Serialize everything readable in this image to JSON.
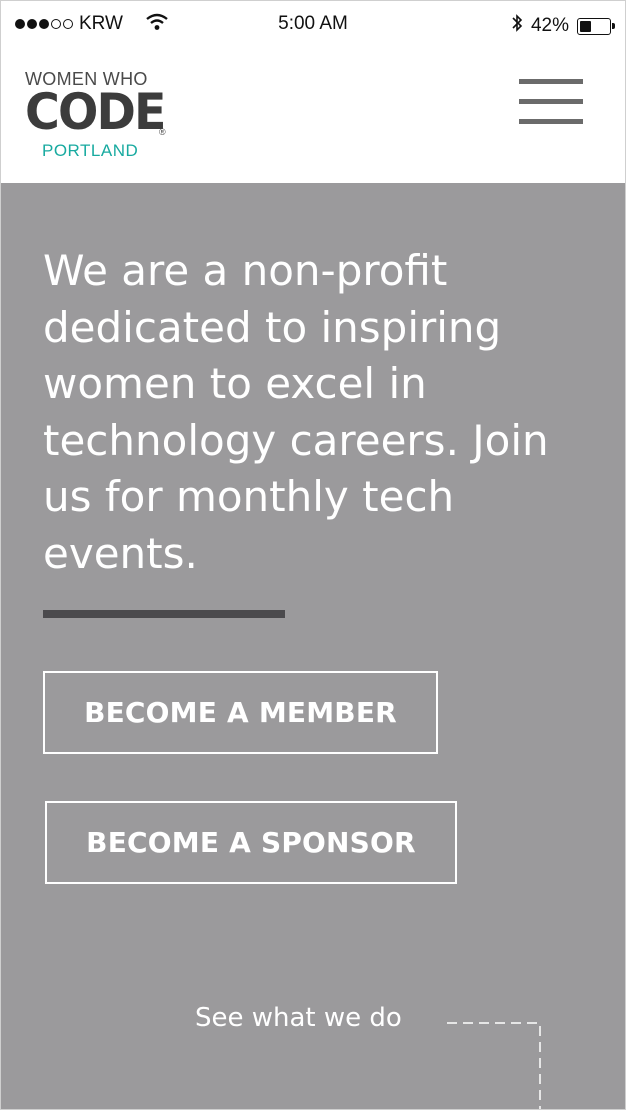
{
  "status_bar": {
    "carrier": "KRW",
    "time": "5:00 AM",
    "battery_percent": "42%",
    "battery_level": 0.42,
    "signal_bars_filled": 3,
    "signal_bars_total": 5,
    "icons": [
      "wifi-icon",
      "bluetooth-icon",
      "battery-icon"
    ]
  },
  "header": {
    "logo_line1": "WOMEN WHO",
    "logo_line2": "CODE",
    "logo_registered": "®",
    "logo_line3": "PORTLAND",
    "menu_icon": "hamburger-menu-icon"
  },
  "hero": {
    "headline": "We are a non-profit dedicated to inspiring women to excel in technology careers. Join us for monthly tech events.",
    "member_button": "BECOME A MEMBER",
    "sponsor_button": "BECOME A SPONSOR",
    "see_what_link": "See what we do"
  },
  "colors": {
    "hero_background": "#9b9a9c",
    "accent_teal": "#18aaa0",
    "divider": "#4b4a4d",
    "text_light": "#ffffff"
  }
}
